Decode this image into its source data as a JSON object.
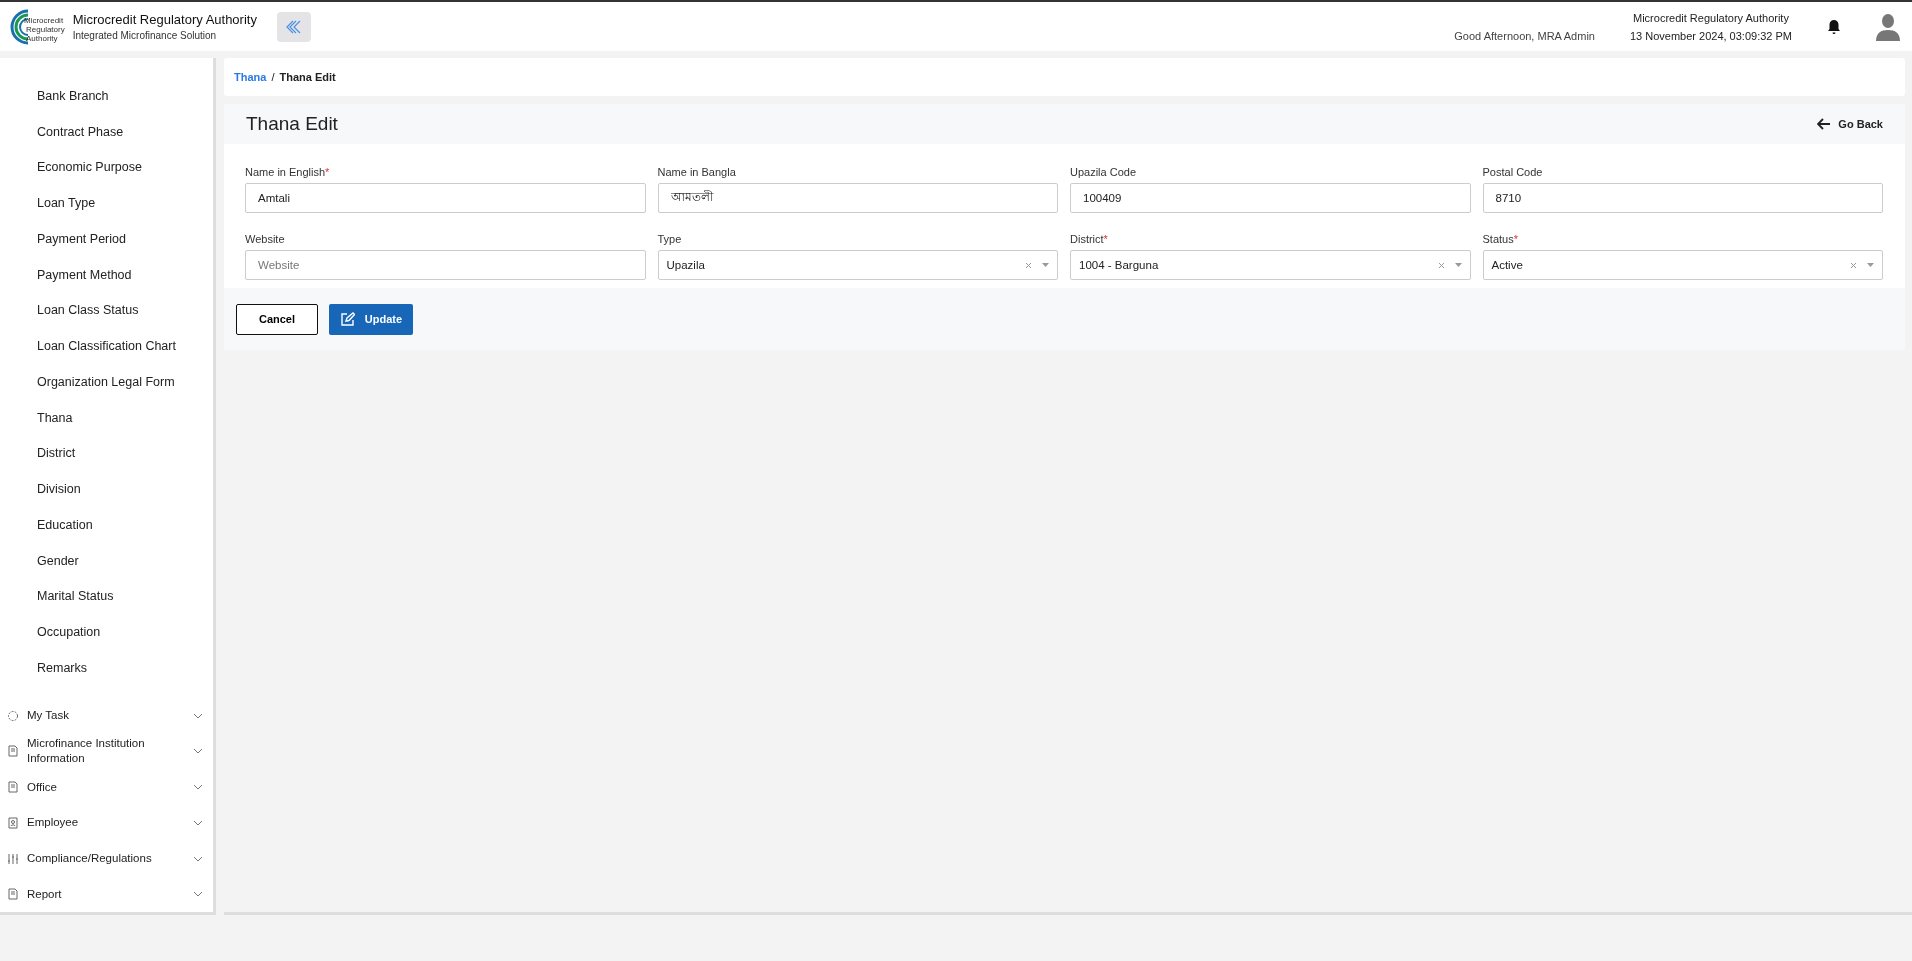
{
  "header": {
    "logo_lines": [
      "Microcredit",
      "Regulatory",
      "Authority"
    ],
    "title": "Microcredit Regulatory Authority",
    "subtitle": "Integrated Microfinance Solution",
    "greeting": "Good Afternoon, MRA Admin",
    "org": "Microcredit Regulatory Authority",
    "datetime": "13 November 2024, 03:09:32 PM"
  },
  "sidebar": {
    "items": [
      {
        "label": "Bank Branch"
      },
      {
        "label": "Contract Phase"
      },
      {
        "label": "Economic Purpose"
      },
      {
        "label": "Loan Type"
      },
      {
        "label": "Payment Period"
      },
      {
        "label": "Payment Method"
      },
      {
        "label": "Loan Class Status"
      },
      {
        "label": "Loan Classification Chart"
      },
      {
        "label": "Organization Legal Form"
      },
      {
        "label": "Thana"
      },
      {
        "label": "District"
      },
      {
        "label": "Division"
      },
      {
        "label": "Education"
      },
      {
        "label": "Gender"
      },
      {
        "label": "Marital Status"
      },
      {
        "label": "Occupation"
      },
      {
        "label": "Remarks"
      }
    ],
    "menus": [
      {
        "label": "My Task",
        "kind": "task"
      },
      {
        "label": "Microfinance Institution Information",
        "kind": "doc"
      },
      {
        "label": "Office",
        "kind": "doc"
      },
      {
        "label": "Employee",
        "kind": "person"
      },
      {
        "label": "Compliance/Regulations",
        "kind": "sliders"
      },
      {
        "label": "Report",
        "kind": "doc"
      }
    ]
  },
  "breadcrumb": {
    "link": "Thana",
    "separator": "/",
    "current": "Thana Edit"
  },
  "form": {
    "title": "Thana Edit",
    "back": "Go Back",
    "fields": [
      {
        "label": "Name in English",
        "required_mark": "*",
        "kind": "text",
        "value": "Amtali"
      },
      {
        "label": "Name in Bangla",
        "kind": "text",
        "value": "আমতলী"
      },
      {
        "label": "Upazila Code",
        "kind": "text",
        "value": "100409"
      },
      {
        "label": "Postal Code",
        "kind": "text",
        "value": "8710"
      },
      {
        "label": "Website",
        "kind": "text",
        "placeholder": "Website"
      },
      {
        "label": "Type",
        "kind": "select",
        "value": "Upazila"
      },
      {
        "label": "District",
        "required_mark": "*",
        "kind": "select",
        "value": "1004 - Barguna"
      },
      {
        "label": "Status",
        "required_mark": "*",
        "kind": "select",
        "value": "Active"
      }
    ],
    "cancel": "Cancel",
    "update": "Update"
  }
}
